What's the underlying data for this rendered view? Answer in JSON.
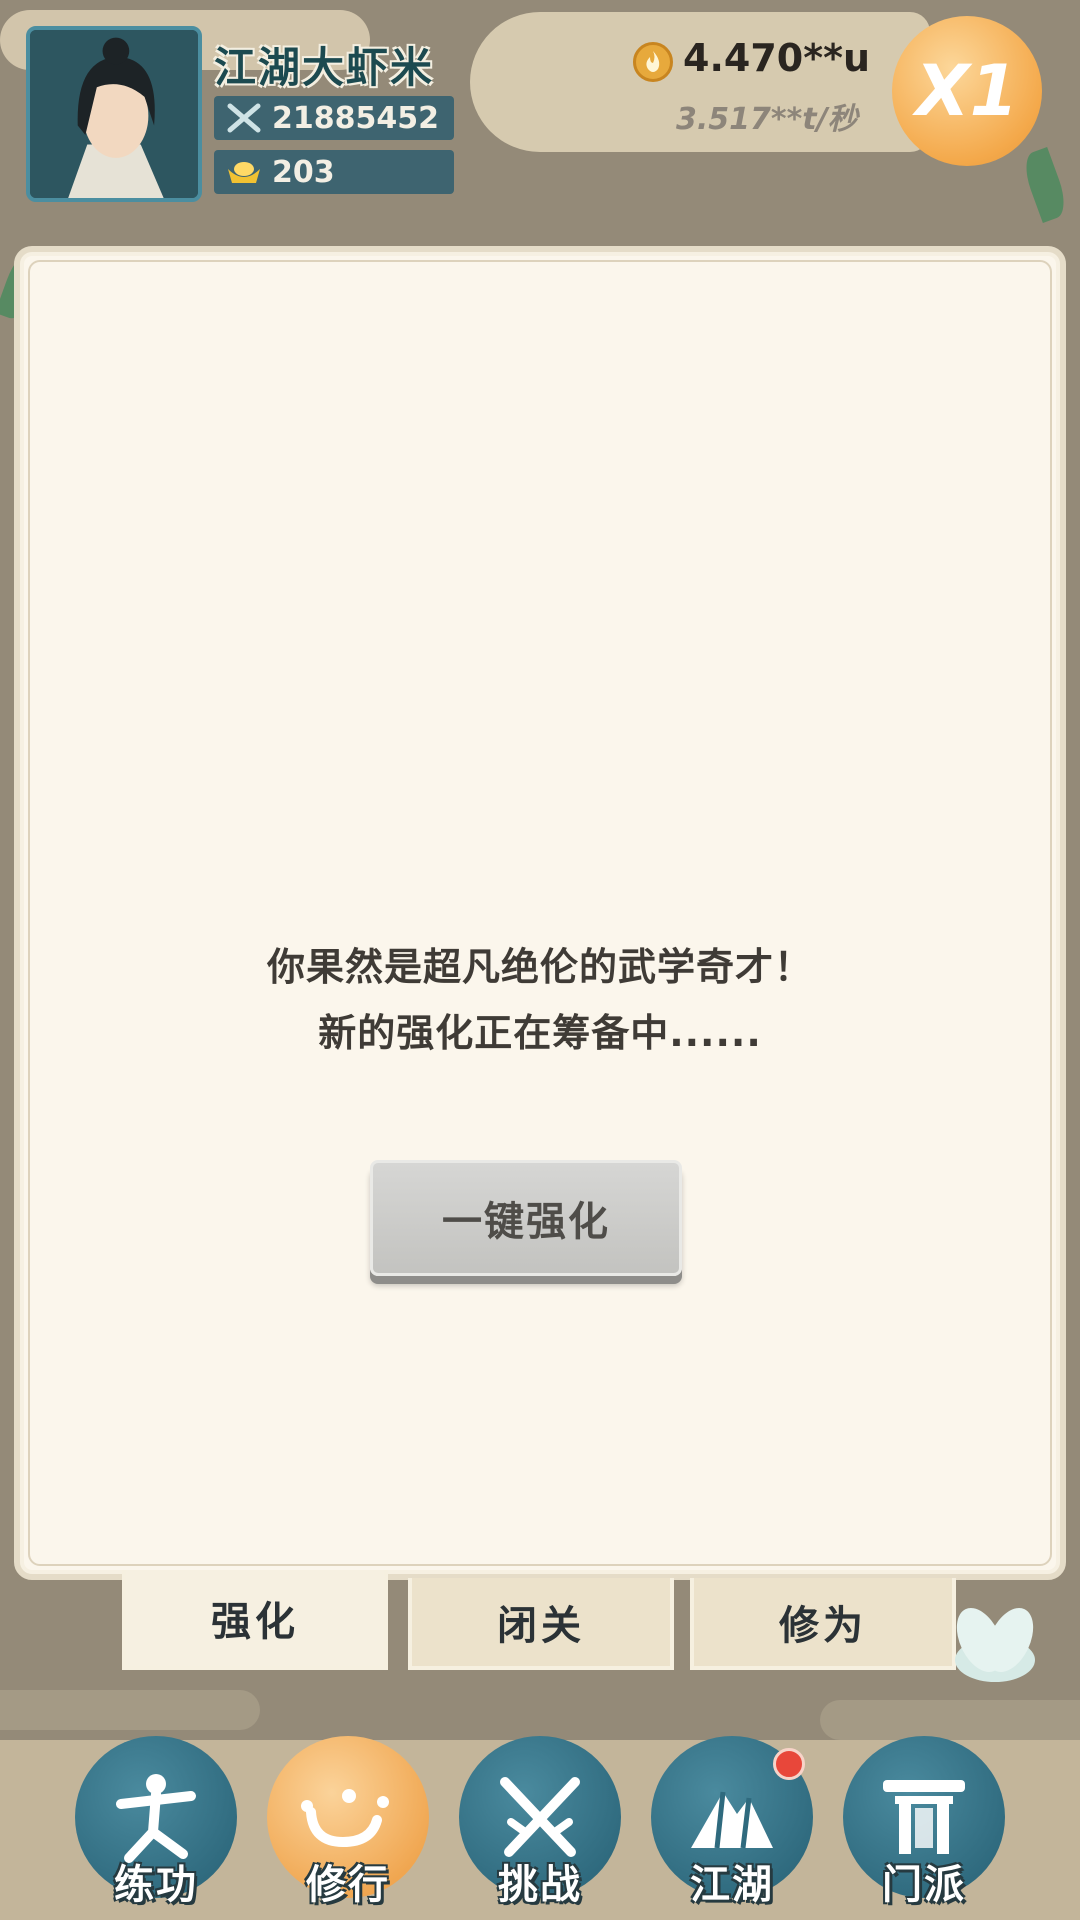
{
  "player": {
    "name": "江湖大虾米",
    "power": "21885452",
    "gold": "203"
  },
  "currency": {
    "total": "4.470**u",
    "rate": "3.517**t/秒"
  },
  "speed_button": {
    "label": "X1"
  },
  "main_panel": {
    "message_line1": "你果然是超凡绝伦的武学奇才！",
    "message_line2": "新的强化正在筹备中......",
    "one_key_button": "一键强化"
  },
  "sub_tabs": [
    {
      "label": "强化",
      "active": true
    },
    {
      "label": "闭关",
      "active": false
    },
    {
      "label": "修为",
      "active": false
    }
  ],
  "bottom_nav": [
    {
      "label": "练功",
      "icon": "martial-pose-icon",
      "active": false
    },
    {
      "label": "修行",
      "icon": "heart-char-icon",
      "active": true
    },
    {
      "label": "挑战",
      "icon": "crossed-swords-icon",
      "active": false,
      "badge": true
    },
    {
      "label": "江湖",
      "icon": "mountain-icon",
      "active": false
    },
    {
      "label": "门派",
      "icon": "gate-icon",
      "active": false
    }
  ],
  "colors": {
    "background": "#948a78",
    "panel": "#fbf6ec",
    "nav_active": "#f0a650",
    "nav_default": "#2f6a7e",
    "badge": "#e8473a"
  }
}
